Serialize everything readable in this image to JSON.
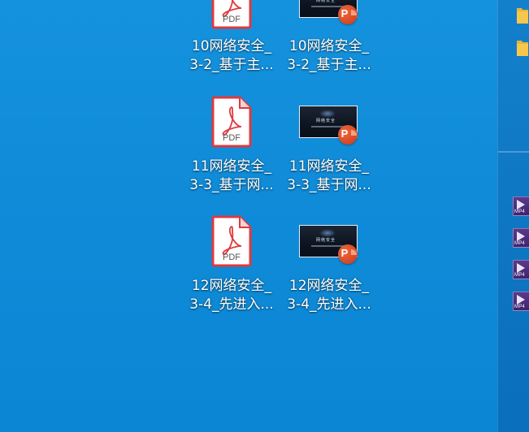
{
  "desktop": {
    "icons": [
      {
        "type": "pdf",
        "badge": "PDF",
        "line1": "10网络安全_",
        "line2": "3-2_基于主..."
      },
      {
        "type": "ppt",
        "badge": "P",
        "line1": "10网络安全_",
        "line2": "3-2_基于主..."
      },
      {
        "type": "pdf",
        "badge": "PDF",
        "line1": "11网络安全_",
        "line2": "3-3_基于网..."
      },
      {
        "type": "ppt",
        "badge": "P",
        "line1": "11网络安全_",
        "line2": "3-3_基于网..."
      },
      {
        "type": "pdf",
        "badge": "PDF",
        "line1": "12网络安全_",
        "line2": "3-4_先进入..."
      },
      {
        "type": "ppt",
        "badge": "P",
        "line1": "12网络安全_",
        "line2": "3-4_先进入..."
      }
    ]
  },
  "right_panel": {
    "folders": [
      "folder-icon",
      "folder-icon"
    ],
    "videos": [
      "MP4",
      "MP4",
      "MP4",
      "MP4"
    ]
  },
  "colors": {
    "desktop_bg": "#0f8bd8",
    "pdf_red": "#e0393e",
    "ppt_orange": "#d24726",
    "mp4_purple": "#4a2c7d",
    "folder_yellow": "#f5c84c"
  }
}
